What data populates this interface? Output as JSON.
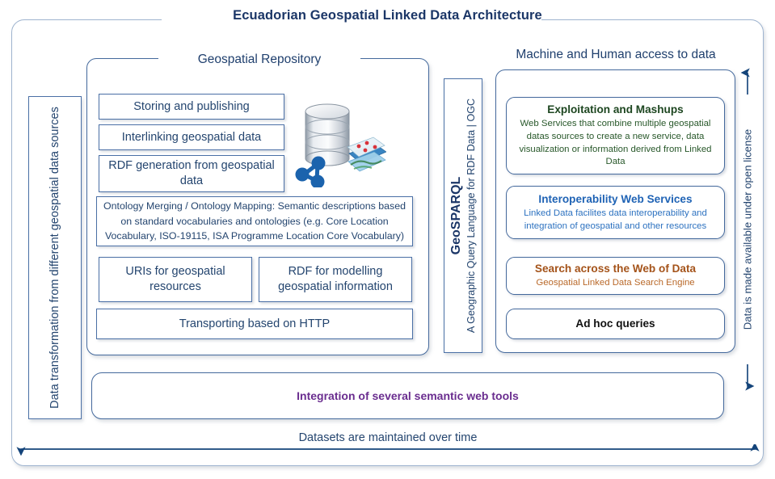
{
  "diagram": {
    "title": "Ecuadorian Geospatial Linked Data Architecture",
    "colors": {
      "frame_border": "#9fb4cf",
      "panel_border": "#44699c",
      "title_navy": "#1b3667",
      "body_blue": "#24456f",
      "exploit_green": "#1d4620",
      "interop_blue": "#1f63b5",
      "search_orange": "#a4531a",
      "adhoc_black": "#111111",
      "integration_purple": "#6a2d8f"
    }
  },
  "left_axis": {
    "label": "Data  transformation from different geospatial data sources"
  },
  "repository": {
    "title": "Geospatial Repository",
    "icon": "database-map-graph-icon",
    "boxes": [
      {
        "id": "storing",
        "label": "Storing and publishing"
      },
      {
        "id": "interlinking",
        "label": "Interlinking geospatial data"
      },
      {
        "id": "rdf_generation",
        "label": "RDF generation from geospatial data"
      },
      {
        "id": "ontology_merging",
        "label": "Ontology Merging / Ontology Mapping: Semantic descriptions based on standard vocabularies and ontologies (e.g. Core Location Vocabulary, ISO-19115, ISA Programme Location Core Vocabulary)"
      },
      {
        "id": "uris",
        "label": "URIs for geospatial resources"
      },
      {
        "id": "rdf_modelling",
        "label": "RDF for modelling geospatial information"
      },
      {
        "id": "transport",
        "label": "Transporting based on HTTP"
      }
    ]
  },
  "geosparql": {
    "title": "GeoSPARQL",
    "subtitle": "A Geographic Query Language for RDF Data | OGC"
  },
  "machine_human": {
    "title": "Machine and Human access to data",
    "boxes": [
      {
        "id": "exploitation",
        "heading": "Exploitation and Mashups",
        "body": "Web Services that combine multiple geospatial datas sources to create a new service, data visualization or information derived from Linked Data"
      },
      {
        "id": "interoperability",
        "heading": "Interoperability Web Services",
        "body": "Linked Data facilites data interoperability and integration of geospatial and other resources"
      },
      {
        "id": "search",
        "heading": "Search across the Web of Data",
        "body": "Geospatial Linked Data Search Engine"
      },
      {
        "id": "adhoc",
        "heading": "Ad hoc queries",
        "body": ""
      }
    ]
  },
  "right_axis": {
    "label": "Data is made available under open license"
  },
  "integration": {
    "label": "Integration of several semantic web tools"
  },
  "bottom_axis": {
    "label": "Datasets are maintained over time"
  }
}
